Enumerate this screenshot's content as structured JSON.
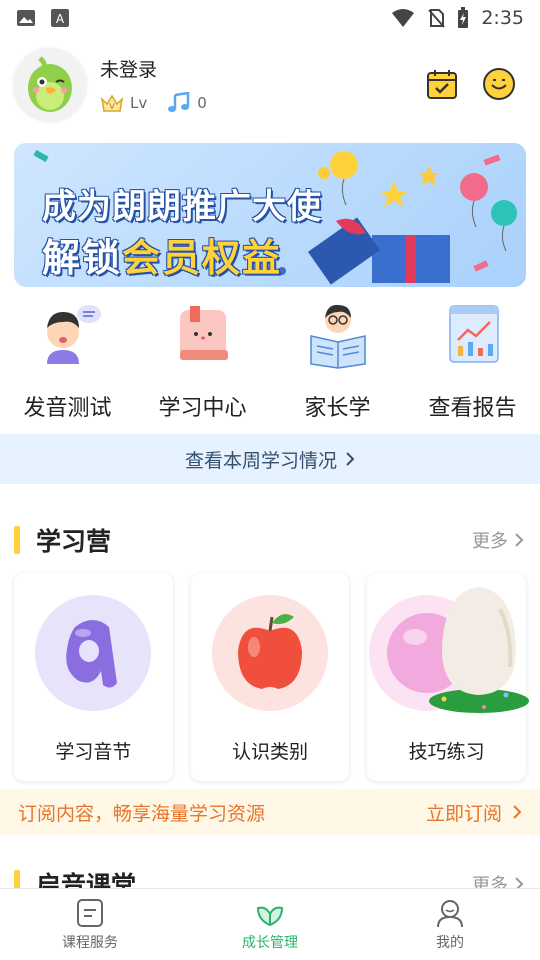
{
  "status_bar": {
    "time": "2:35"
  },
  "profile": {
    "username": "未登录",
    "level_label": "Lv",
    "music_count": "0"
  },
  "banner": {
    "line1": "成为朗朗推广大使",
    "line2_prefix": "解锁",
    "line2_highlight": "会员权益"
  },
  "quick_actions": [
    {
      "label": "发音测试",
      "icon": "pronunciation-test-icon"
    },
    {
      "label": "学习中心",
      "icon": "learning-center-icon"
    },
    {
      "label": "家长学",
      "icon": "parent-study-icon"
    },
    {
      "label": "查看报告",
      "icon": "report-icon"
    }
  ],
  "weekly_link": "查看本周学习情况",
  "camp_section": {
    "title": "学习营",
    "more": "更多",
    "cards": [
      {
        "label": "学习音节",
        "icon": "syllable-icon",
        "circle_color": "#e7e3fa"
      },
      {
        "label": "认识类别",
        "icon": "apple-icon",
        "circle_color": "#fde3df"
      },
      {
        "label": "技巧练习",
        "icon": "egg-icon",
        "circle_color": "#fbe3f3"
      }
    ]
  },
  "promo": {
    "text": "订阅内容，畅享海量学习资源",
    "cta": "立即订阅"
  },
  "enlighten_section": {
    "title": "启音课堂",
    "more": "更多"
  },
  "bottom_nav": [
    {
      "label": "课程服务",
      "icon": "course-icon",
      "active": false
    },
    {
      "label": "成长管理",
      "icon": "leaf-icon",
      "active": true
    },
    {
      "label": "我的",
      "icon": "profile-icon",
      "active": false
    }
  ],
  "colors": {
    "accent": "#ffd23b",
    "nav_active": "#2db36b",
    "promo_text": "#e8742a",
    "weekly_bg": "#e6f2ff"
  }
}
